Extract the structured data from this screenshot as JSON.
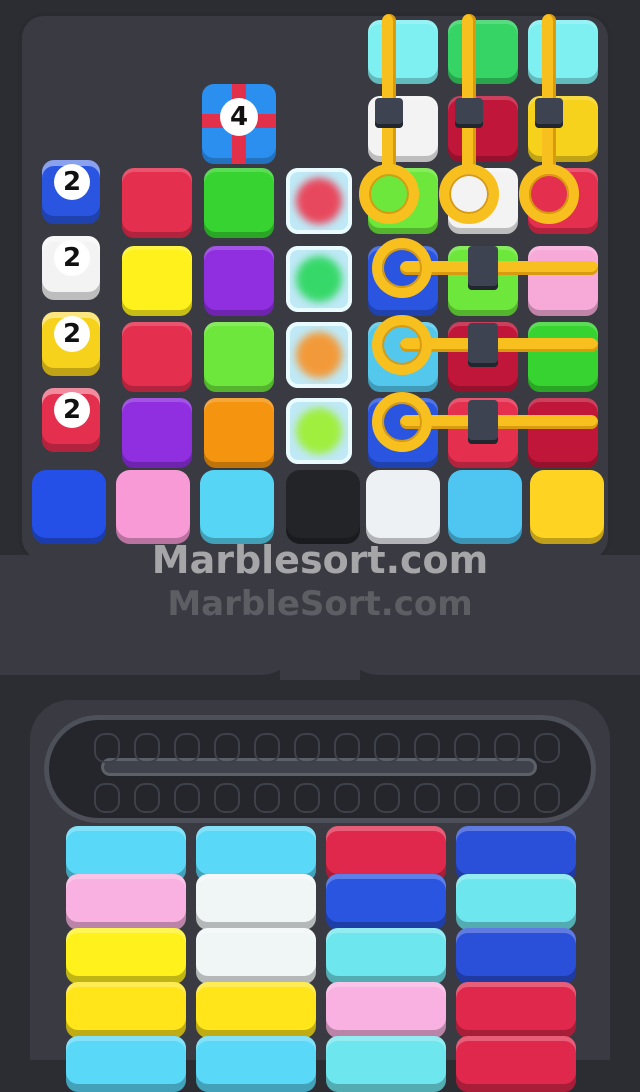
{
  "watermark": {
    "primary": "Marblesort.com",
    "secondary": "MarbleSort.com"
  },
  "gift_counter": "4",
  "queue_cubes": [
    {
      "count": "2",
      "color": "#2a55e0"
    },
    {
      "count": "2",
      "color": "#f3f3f3"
    },
    {
      "count": "2",
      "color": "#f7d21c"
    },
    {
      "count": "2",
      "color": "#e52f4f"
    }
  ],
  "grid_tiles": [
    [
      "#e52f4f",
      "#37d431",
      "ice-red",
      "pinned",
      "pinned",
      "pinned"
    ],
    [
      "#fff21c",
      "#8f2fe0",
      "ice-green",
      "#2a55e0",
      "#6de73c",
      "#f7a9d8"
    ],
    [
      "#e52f4f",
      "#6de73c",
      "ice-orange",
      "#53c7ec",
      "#c0163a",
      "#37d431"
    ],
    [
      "#8f2fe0",
      "#f5940f",
      "ice-lime",
      "#2a55e0",
      "#e52f4f",
      "#c0163a"
    ]
  ],
  "top_pinned": [
    "#7ff0f2",
    "#35d465",
    "#7ff0f2"
  ],
  "pinned_under": [
    "#f3f3f3",
    "#c0163a",
    "#f7d21c"
  ],
  "pop_row": [
    {
      "name": "pop-blue",
      "color": "#2450e8"
    },
    {
      "name": "pop-pink",
      "color": "#f89ad6"
    },
    {
      "name": "pop-cyan",
      "color": "#57d5f4"
    },
    {
      "name": "pop-empty",
      "color": "#232428"
    },
    {
      "name": "pop-white",
      "color": "#eef1f4"
    },
    {
      "name": "pop-cyan-2",
      "color": "#4fc6f2"
    },
    {
      "name": "pop-yellow",
      "color": "#ffd322"
    }
  ],
  "bins": [
    [
      "#5ad8f7",
      "#f8b1e0",
      "#fff21c",
      "#ffe51a",
      "#5ad8f7"
    ],
    [
      "#5ad8f7",
      "#f0f6f6",
      "#f0f6f6",
      "#ffe51a",
      "#5ad8f7"
    ],
    [
      "#e0284c",
      "#2a55e0",
      "#6ee6ee",
      "#f8b1e0",
      "#6ee6ee"
    ],
    [
      "#2a4fd8",
      "#6ee6ee",
      "#2a4fd8",
      "#e0284c",
      "#e0284c"
    ]
  ],
  "colors": {
    "pin": "#f8c01e",
    "board": "#3a3b42",
    "background": "#2c2d33"
  }
}
